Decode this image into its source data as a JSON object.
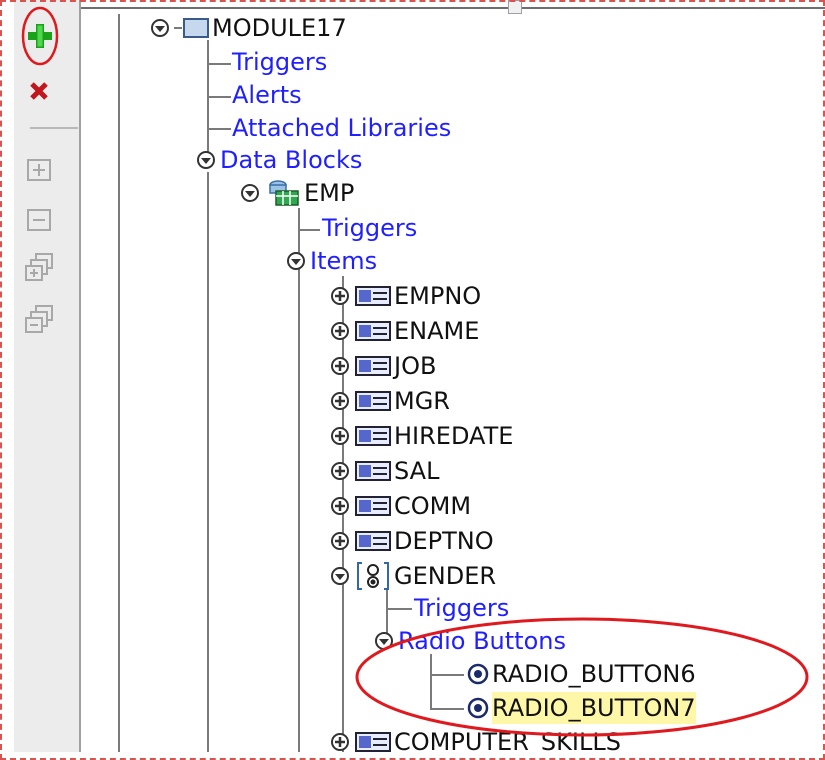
{
  "tree": {
    "module": {
      "label": "MODULE17"
    },
    "triggers": {
      "label": "Triggers"
    },
    "alerts": {
      "label": "Alerts"
    },
    "attached_libraries": {
      "label": "Attached Libraries"
    },
    "data_blocks": {
      "label": "Data Blocks"
    },
    "emp": {
      "label": "EMP"
    },
    "emp_triggers": {
      "label": "Triggers"
    },
    "items": {
      "label": "Items"
    },
    "item_list": [
      {
        "label": "EMPNO"
      },
      {
        "label": "ENAME"
      },
      {
        "label": "JOB"
      },
      {
        "label": "MGR"
      },
      {
        "label": "HIREDATE"
      },
      {
        "label": "SAL"
      },
      {
        "label": "COMM"
      },
      {
        "label": "DEPTNO"
      }
    ],
    "gender": {
      "label": "GENDER"
    },
    "gender_triggers": {
      "label": "Triggers"
    },
    "radio_buttons": {
      "label": "Radio Buttons"
    },
    "radio_button6": {
      "label": "RADIO_BUTTON6"
    },
    "radio_button7": {
      "label": "RADIO_BUTTON7"
    },
    "computer_skills": {
      "label": "COMPUTER_SKILLS"
    }
  },
  "colors": {
    "link_blue": "#1f1fff",
    "highlight": "#fff7a8",
    "annotation_red": "#e0191e",
    "create_green": "#1aa31a",
    "delete_red": "#c0161c"
  }
}
